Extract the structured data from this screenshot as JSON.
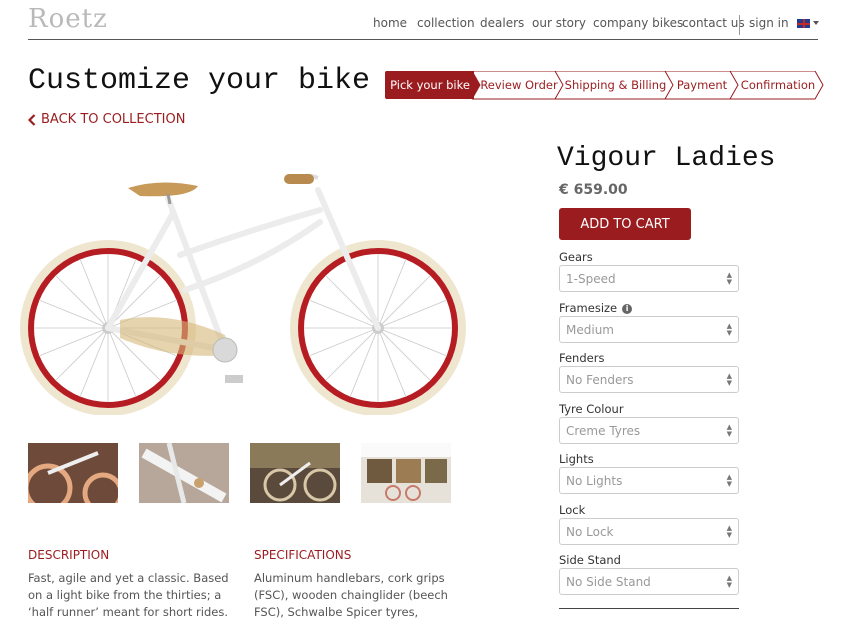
{
  "header": {
    "logo": "Roetz",
    "nav": [
      {
        "label": "home",
        "key": "home"
      },
      {
        "label": "collection",
        "key": "collection"
      },
      {
        "label": "dealers",
        "key": "dealers"
      },
      {
        "label": "our story",
        "key": "our-story"
      },
      {
        "label": "company bikes",
        "key": "company-bikes"
      },
      {
        "label": "contact us",
        "key": "contact-us"
      }
    ],
    "sign_in": "sign in",
    "language_flag": "uk-flag-icon"
  },
  "page": {
    "title": "Customize your bike",
    "back_link": "BACK TO COLLECTION"
  },
  "steps": [
    {
      "label": "Pick your bike",
      "active": true
    },
    {
      "label": "Review Order",
      "active": false
    },
    {
      "label": "Shipping & Billing",
      "active": false
    },
    {
      "label": "Payment",
      "active": false
    },
    {
      "label": "Confirmation",
      "active": false
    }
  ],
  "product": {
    "name": "Vigour Ladies",
    "price": "€ 659.00",
    "add_to_cart": "ADD TO CART",
    "options": [
      {
        "label": "Gears",
        "value": "1-Speed"
      },
      {
        "label": "Framesize",
        "value": "Medium",
        "info": true
      },
      {
        "label": "Fenders",
        "value": "No Fenders"
      },
      {
        "label": "Tyre Colour",
        "value": "Creme Tyres"
      },
      {
        "label": "Lights",
        "value": "No Lights"
      },
      {
        "label": "Lock",
        "value": "No Lock"
      },
      {
        "label": "Side Stand",
        "value": "No Side Stand"
      }
    ]
  },
  "description": {
    "title": "DESCRIPTION",
    "lines": [
      "Fast, agile and yet a classic. Based",
      "on a light bike from the thirties; a",
      "‘half runner’ meant for short rides."
    ]
  },
  "specifications": {
    "title": "SPECIFICATIONS",
    "lines": [
      "Aluminum handlebars, cork grips",
      "(FSC), wooden chainglider (beech",
      "FSC), Schwalbe Spicer tyres,"
    ]
  },
  "colors": {
    "accent": "#9b1c1f",
    "tyre": "#efe6cf",
    "rim": "#b51d22",
    "frame": "#f4f4f4"
  }
}
